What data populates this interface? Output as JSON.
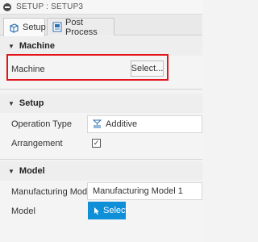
{
  "window": {
    "title": "SETUP : SETUP3"
  },
  "tabs": [
    {
      "label": "Setup",
      "active": true,
      "icon": "setup-cube-icon"
    },
    {
      "label": "Post Process",
      "active": false,
      "icon": "post-process-icon"
    }
  ],
  "machine_section": {
    "title": "Machine",
    "machine_label": "Machine",
    "select_label": "Select..."
  },
  "setup_section": {
    "title": "Setup",
    "operation_type_label": "Operation Type",
    "operation_type_value": "Additive",
    "arrangement_label": "Arrangement",
    "arrangement_checked": true
  },
  "model_section": {
    "title": "Model",
    "manufacturing_model_label": "Manufacturing Model",
    "manufacturing_model_value": "Manufacturing Model 1",
    "model_label": "Model",
    "model_button_label": "Select"
  },
  "colors": {
    "highlight": "#e3141b",
    "accent_blue": "#0e8fd8"
  }
}
